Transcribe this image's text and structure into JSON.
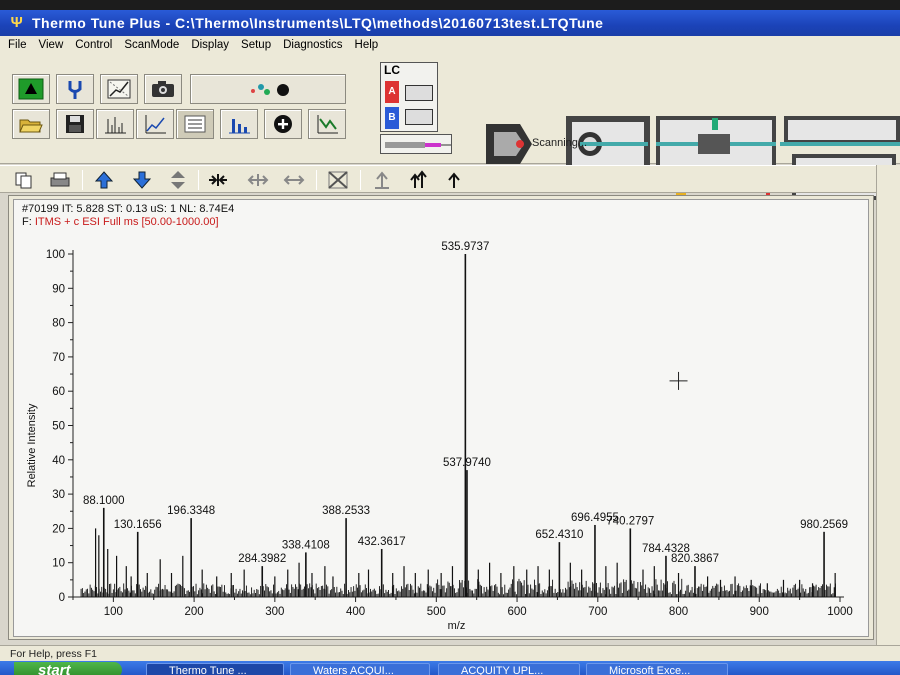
{
  "window": {
    "title": "Thermo Tune Plus - C:\\Thermo\\Instruments\\LTQ\\methods\\20160713test.LTQTune"
  },
  "menu": [
    "File",
    "View",
    "Control",
    "ScanMode",
    "Display",
    "Setup",
    "Diagnostics",
    "Help"
  ],
  "toolbar": {
    "lc_label": "LC",
    "lc_a": "A",
    "lc_b": "B",
    "status": "Scanning..."
  },
  "spectrum": {
    "scan_info": "#70199  IT: 5.828  ST: 0.13  uS: 1  NL: 8.74E4",
    "filter_prefix": "F:",
    "filter": "ITMS + c ESI Full ms [50.00-1000.00]"
  },
  "chart_data": {
    "type": "bar",
    "xlabel": "m/z",
    "ylabel": "Relative Intensity",
    "xlim": [
      50,
      1000
    ],
    "ylim": [
      0,
      100
    ],
    "xticks": [
      100,
      200,
      300,
      400,
      500,
      600,
      700,
      800,
      900,
      1000
    ],
    "yticks": [
      0,
      10,
      20,
      30,
      40,
      50,
      60,
      70,
      80,
      90,
      100
    ],
    "labeled_peaks": [
      {
        "mz": 88.1,
        "intensity": 26,
        "label": "88.1000"
      },
      {
        "mz": 130.1656,
        "intensity": 19,
        "label": "130.1656"
      },
      {
        "mz": 196.3348,
        "intensity": 23,
        "label": "196.3348"
      },
      {
        "mz": 284.3982,
        "intensity": 9,
        "label": "284.3982"
      },
      {
        "mz": 338.4108,
        "intensity": 13,
        "label": "338.4108"
      },
      {
        "mz": 388.2533,
        "intensity": 23,
        "label": "388.2533"
      },
      {
        "mz": 432.3617,
        "intensity": 14,
        "label": "432.3617"
      },
      {
        "mz": 535.9737,
        "intensity": 100,
        "label": "535.9737"
      },
      {
        "mz": 537.974,
        "intensity": 37,
        "label": "537.9740"
      },
      {
        "mz": 652.431,
        "intensity": 16,
        "label": "652.4310"
      },
      {
        "mz": 696.4955,
        "intensity": 21,
        "label": "696.4955"
      },
      {
        "mz": 740.2797,
        "intensity": 20,
        "label": "740.2797"
      },
      {
        "mz": 784.4328,
        "intensity": 12,
        "label": "784.4328"
      },
      {
        "mz": 820.3867,
        "intensity": 9,
        "label": "820.3867"
      },
      {
        "mz": 980.2569,
        "intensity": 19,
        "label": "980.2569"
      }
    ],
    "minor_peaks": [
      {
        "mz": 78,
        "intensity": 20
      },
      {
        "mz": 82,
        "intensity": 18
      },
      {
        "mz": 93,
        "intensity": 14
      },
      {
        "mz": 104,
        "intensity": 12
      },
      {
        "mz": 116,
        "intensity": 9
      },
      {
        "mz": 122,
        "intensity": 6
      },
      {
        "mz": 142,
        "intensity": 7
      },
      {
        "mz": 158,
        "intensity": 11
      },
      {
        "mz": 172,
        "intensity": 7
      },
      {
        "mz": 186,
        "intensity": 12
      },
      {
        "mz": 210,
        "intensity": 8
      },
      {
        "mz": 228,
        "intensity": 6
      },
      {
        "mz": 246,
        "intensity": 7
      },
      {
        "mz": 262,
        "intensity": 8
      },
      {
        "mz": 300,
        "intensity": 6
      },
      {
        "mz": 316,
        "intensity": 8
      },
      {
        "mz": 330,
        "intensity": 10
      },
      {
        "mz": 346,
        "intensity": 7
      },
      {
        "mz": 362,
        "intensity": 9
      },
      {
        "mz": 372,
        "intensity": 6
      },
      {
        "mz": 404,
        "intensity": 7
      },
      {
        "mz": 416,
        "intensity": 8
      },
      {
        "mz": 446,
        "intensity": 7
      },
      {
        "mz": 460,
        "intensity": 9
      },
      {
        "mz": 474,
        "intensity": 7
      },
      {
        "mz": 490,
        "intensity": 8
      },
      {
        "mz": 506,
        "intensity": 7
      },
      {
        "mz": 520,
        "intensity": 9
      },
      {
        "mz": 552,
        "intensity": 8
      },
      {
        "mz": 566,
        "intensity": 10
      },
      {
        "mz": 580,
        "intensity": 7
      },
      {
        "mz": 596,
        "intensity": 9
      },
      {
        "mz": 612,
        "intensity": 8
      },
      {
        "mz": 626,
        "intensity": 9
      },
      {
        "mz": 640,
        "intensity": 8
      },
      {
        "mz": 666,
        "intensity": 10
      },
      {
        "mz": 680,
        "intensity": 8
      },
      {
        "mz": 710,
        "intensity": 9
      },
      {
        "mz": 724,
        "intensity": 10
      },
      {
        "mz": 756,
        "intensity": 8
      },
      {
        "mz": 770,
        "intensity": 9
      },
      {
        "mz": 800,
        "intensity": 7
      },
      {
        "mz": 836,
        "intensity": 6
      },
      {
        "mz": 852,
        "intensity": 5
      },
      {
        "mz": 870,
        "intensity": 6
      },
      {
        "mz": 890,
        "intensity": 5
      },
      {
        "mz": 910,
        "intensity": 4
      },
      {
        "mz": 930,
        "intensity": 5
      },
      {
        "mz": 950,
        "intensity": 5
      },
      {
        "mz": 966,
        "intensity": 4
      },
      {
        "mz": 994,
        "intensity": 7
      }
    ],
    "cursor": {
      "mz": 800,
      "intensity": 63
    },
    "colors": {
      "trace": "#111111",
      "axis": "#222222",
      "filter_text": "#c81a1a"
    }
  },
  "status_bar": {
    "help": "For Help, press F1"
  },
  "taskbar": {
    "start": "start",
    "items": [
      "Thermo Tune ...",
      "Waters ACQUI...",
      "ACQUITY UPL...",
      "Microsoft Exce..."
    ]
  }
}
